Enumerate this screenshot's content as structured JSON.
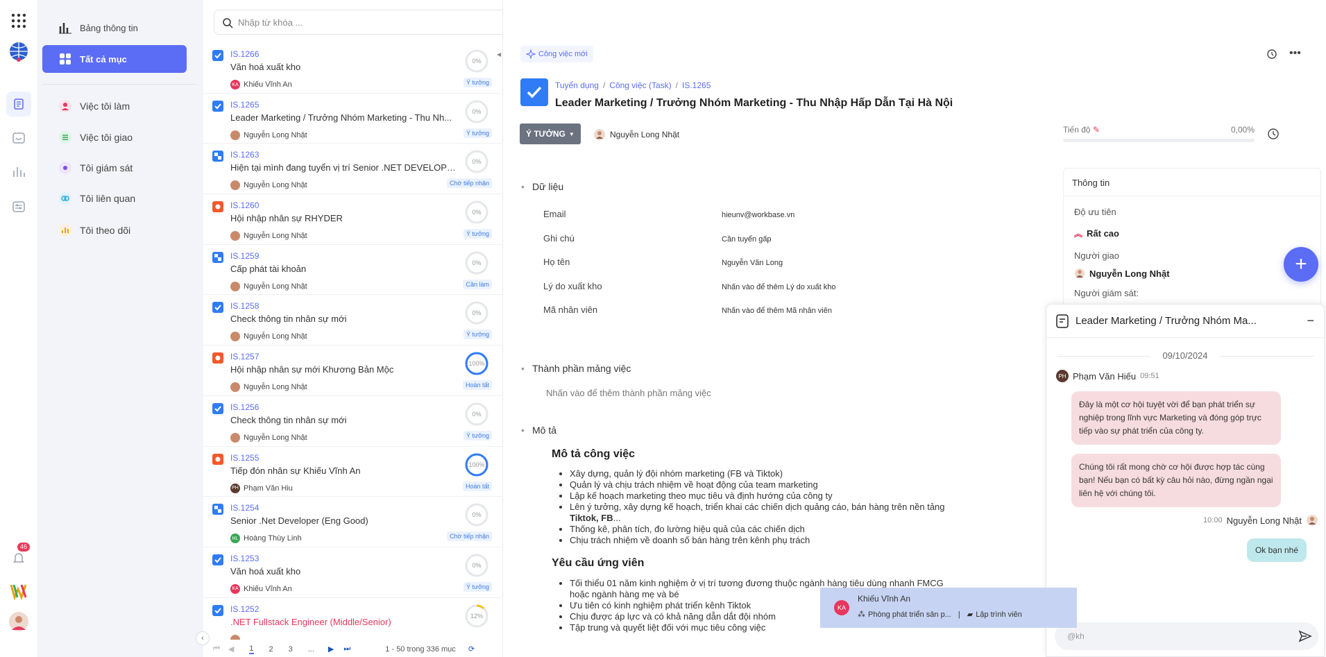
{
  "nav": {
    "dashboard": "Bảng thông tin",
    "all_items": "Tất cả mục",
    "my_work": "Việc tôi làm",
    "assigned": "Việc tôi giao",
    "supervising": "Tôi giám sát",
    "related": "Tôi liên quan",
    "following": "Tôi theo dõi"
  },
  "rail": {
    "notif_count": "46"
  },
  "search": {
    "placeholder": "Nhập từ khóa ..."
  },
  "items": [
    {
      "code": "IS.1266",
      "title": "Văn hoá xuất kho",
      "assignee": "Khiếu Vĩnh An",
      "av": "KA",
      "avc": "#e8365d",
      "pct": "0%",
      "p": 0,
      "status": "Ý tưởng",
      "type": "check",
      "red": false
    },
    {
      "code": "IS.1265",
      "title": "Leader Marketing / Trưởng Nhóm Marketing - Thu Nh...",
      "assignee": "Nguyễn Long Nhật",
      "av": "",
      "avc": "#c98a6a",
      "pct": "0%",
      "p": 0,
      "status": "Ý tưởng",
      "type": "check",
      "red": false
    },
    {
      "code": "IS.1263",
      "title": "Hiện tại mình đang tuyển vị trí Senior .NET DEVELOPE...",
      "assignee": "Nguyễn Long Nhật",
      "av": "",
      "avc": "#c98a6a",
      "pct": "0%",
      "p": 0,
      "status": "Chờ tiếp nhận",
      "type": "sub",
      "red": false
    },
    {
      "code": "IS.1260",
      "title": "Hội nhập nhân sự RHYDER",
      "assignee": "Nguyễn Long Nhật",
      "av": "",
      "avc": "#c98a6a",
      "pct": "0%",
      "p": 0,
      "status": "Ý tưởng",
      "type": "bug",
      "red": false
    },
    {
      "code": "IS.1259",
      "title": "Cấp phát tài khoản",
      "assignee": "Nguyễn Long Nhật",
      "av": "",
      "avc": "#c98a6a",
      "pct": "0%",
      "p": 0,
      "status": "Cần làm",
      "type": "sub",
      "red": false
    },
    {
      "code": "IS.1258",
      "title": "Check thông tin nhân sự mới",
      "assignee": "Nguyễn Long Nhật",
      "av": "",
      "avc": "#c98a6a",
      "pct": "0%",
      "p": 0,
      "status": "Ý tưởng",
      "type": "check",
      "red": false
    },
    {
      "code": "IS.1257",
      "title": "Hội nhập nhân sự mới Khương Bản Mộc",
      "assignee": "Nguyễn Long Nhật",
      "av": "",
      "avc": "#c98a6a",
      "pct": "100%",
      "p": 100,
      "status": "Hoàn tất",
      "type": "bug",
      "red": false
    },
    {
      "code": "IS.1256",
      "title": "Check thông tin nhân sự mới",
      "assignee": "Nguyễn Long Nhật",
      "av": "",
      "avc": "#c98a6a",
      "pct": "0%",
      "p": 0,
      "status": "Ý tưởng",
      "type": "check",
      "red": false
    },
    {
      "code": "IS.1255",
      "title": "Tiếp đón nhân sự Khiếu Vĩnh An",
      "assignee": "Phạm Văn Hiu",
      "av": "PH",
      "avc": "#5b3a2e",
      "pct": "100%",
      "p": 100,
      "status": "Hoàn tất",
      "type": "bug",
      "red": false
    },
    {
      "code": "IS.1254",
      "title": "Senior .Net Developer (Eng Good)",
      "assignee": "Hoàng Thùy Linh",
      "av": "HL",
      "avc": "#3aa655",
      "pct": "0%",
      "p": 0,
      "status": "Chờ tiếp nhận",
      "type": "sub",
      "red": false
    },
    {
      "code": "IS.1253",
      "title": "Văn hoá xuất kho",
      "assignee": "Khiếu Vĩnh An",
      "av": "KA",
      "avc": "#e8365d",
      "pct": "0%",
      "p": 0,
      "status": "Ý tưởng",
      "type": "check",
      "red": false
    },
    {
      "code": "IS.1252",
      "title": ".NET Fullstack Engineer (Middle/Senior)",
      "assignee": "",
      "av": "",
      "avc": "#c98a6a",
      "pct": "12%",
      "p": 12,
      "status": "",
      "type": "check",
      "red": true
    }
  ],
  "pager": {
    "p1": "1",
    "p2": "2",
    "p3": "3",
    "dots": "...",
    "range": "1 - 50 trong 336 mục"
  },
  "detail": {
    "new_task": "Công việc mới",
    "crumb1": "Tuyển dụng",
    "crumb2": "Công việc (Task)",
    "crumb3": "IS.1265",
    "title": "Leader Marketing / Trưởng Nhóm Marketing - Thu Nhập Hấp Dẫn Tại Hà Nội",
    "status": "Ý TƯỞNG",
    "owner": "Nguyễn Long Nhật",
    "progress_label": "Tiến độ",
    "progress_value": "0,00%",
    "sec_data": "Dữ liệu",
    "fields": [
      {
        "label": "Email",
        "value": "hieunv@workbase.vn"
      },
      {
        "label": "Ghi chú",
        "value": "Cần tuyển gấp"
      },
      {
        "label": "Họ tên",
        "value": "Nguyễn Văn Long"
      },
      {
        "label": "Lý do xuất kho",
        "value": "Nhấn vào để thêm Lý do xuất kho"
      },
      {
        "label": "Mã nhân viên",
        "value": "Nhấn vào để thêm Mã nhân viên"
      }
    ],
    "sec_parts": "Thành phần mảng việc",
    "parts_placeholder": "Nhấn vào để thêm thành phần mảng việc",
    "sec_desc": "Mô tả",
    "desc_h1": "Mô tả công việc",
    "desc_list1": [
      "Xây dựng, quản lý đội nhóm marketing (FB và Tiktok)",
      "Quản lý và chịu trách nhiệm về hoạt động của team marketing",
      "Lập kế hoạch marketing theo mục tiêu và định hướng của công ty",
      "Lên ý tưởng, xây dựng kế hoạch, triển khai các chiến dịch quảng cáo, bán hàng trên nền tảng",
      "Thống kê, phân tích, đo lường hiệu quả của các chiến dịch",
      "Chịu trách nhiệm về doanh số bán hàng trên kênh phụ trách"
    ],
    "desc_bold": "Tiktok, FB",
    "desc_bold_tail": "...",
    "desc_h2": "Yêu cầu ứng viên",
    "desc_list2": [
      "Tối thiểu 01 năm kinh nghiệm ở vị trí tương đương thuộc ngành hàng tiêu dùng nhanh FMCG hoặc ngành hàng mẹ và bé",
      "Ưu tiên có kinh nghiệm phát triển kênh Tiktok",
      "Chịu được áp lực và có khả năng dẫn dắt đội nhóm",
      "Tập trung và quyết liệt đối với mục tiêu công việc"
    ],
    "info_title": "Thông tin",
    "priority_label": "Độ ưu tiên",
    "priority_value": "Rất cao",
    "assigner_label": "Người giao",
    "assigner_value": "Nguyễn Long Nhật",
    "supervisor_label": "Người giám sát:"
  },
  "chat": {
    "title": "Leader Marketing / Trưởng Nhóm Ma...",
    "date": "09/10/2024",
    "sender": "Phạm Văn Hiếu",
    "sender_av": "PH",
    "time1": "09:51",
    "msg1": "Đây là một cơ hội tuyệt vời để bạn phát triển sự nghiệp trong lĩnh vực Marketing và đóng góp trực tiếp vào sự phát triển của công ty.",
    "msg2": "Chúng tôi rất mong chờ cơ hội được hợp tác cùng bạn! Nếu bạn có bất kỳ câu hỏi nào, đừng ngần ngại liên hệ với chúng tôi.",
    "time2": "10:00",
    "me": "Nguyễn Long Nhật",
    "msg3": "Ok bạn nhé",
    "input_value": "@kh"
  },
  "toast": {
    "name": "Khiếu Vĩnh An",
    "av": "KA",
    "dept": "Phòng phát triển sản p...",
    "role": "Lập trình viên"
  },
  "colors": {
    "accent": "#5b6cf5",
    "status_btn": "#6b7280",
    "chat_bubble": "#f7dcdf",
    "my_bubble": "#bfe8ec"
  }
}
